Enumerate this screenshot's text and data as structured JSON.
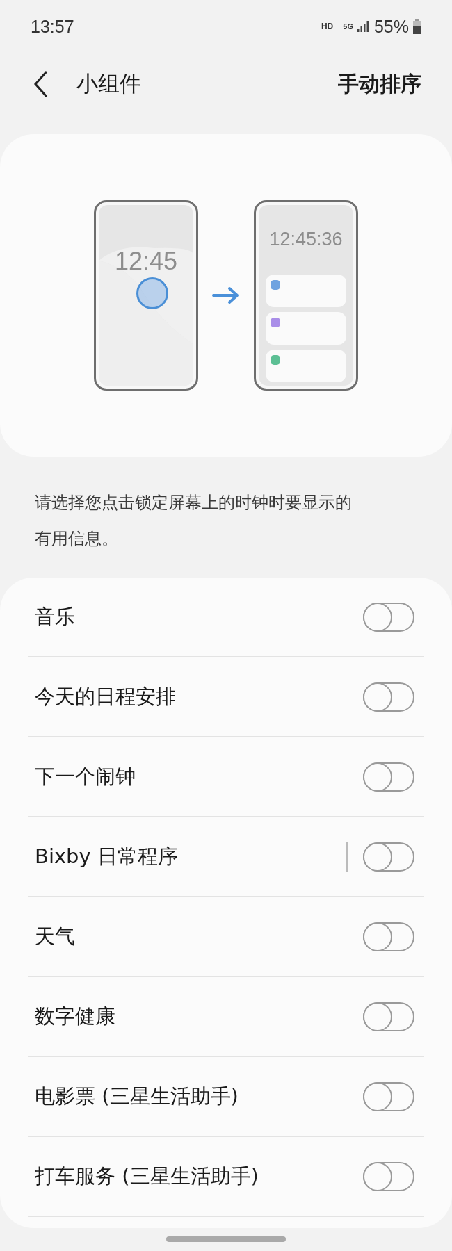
{
  "status_bar": {
    "time": "13:57",
    "hd": "HD",
    "network": "5G",
    "battery": "55%"
  },
  "header": {
    "title": "小组件",
    "action": "手动排序"
  },
  "illustration": {
    "before_clock": "12:45",
    "after_clock": "12:45:36",
    "cards": [
      {
        "color": "#6fa3e0"
      },
      {
        "color": "#a98ee8"
      },
      {
        "color": "#5cbf94"
      }
    ]
  },
  "description": "请选择您点击锁定屏幕上的时钟时要显示的有用信息。",
  "widgets": [
    {
      "label": "音乐",
      "on": false,
      "divider": false
    },
    {
      "label": "今天的日程安排",
      "on": false,
      "divider": false
    },
    {
      "label": "下一个闹钟",
      "on": false,
      "divider": false
    },
    {
      "label": "Bixby 日常程序",
      "on": false,
      "divider": true
    },
    {
      "label": "天气",
      "on": false,
      "divider": false
    },
    {
      "label": "数字健康",
      "on": false,
      "divider": false
    },
    {
      "label": "电影票 (三星生活助手)",
      "on": false,
      "divider": false
    },
    {
      "label": "打车服务 (三星生活助手)",
      "on": false,
      "divider": false
    }
  ]
}
